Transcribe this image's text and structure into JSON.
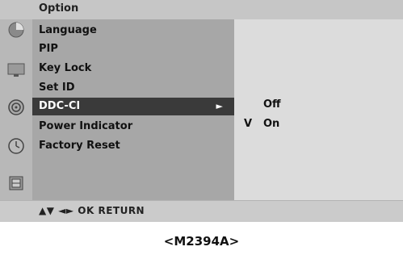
{
  "header": {
    "title": "Option"
  },
  "menu": {
    "items": [
      {
        "label": "Language"
      },
      {
        "label": "PIP"
      },
      {
        "label": "Key Lock"
      },
      {
        "label": "Set ID"
      },
      {
        "label": "DDC-CI",
        "selected": true,
        "arrow": "►"
      },
      {
        "label": "Power Indicator"
      },
      {
        "label": "Factory Reset"
      }
    ]
  },
  "submenu": {
    "options": [
      {
        "check": "",
        "label": "Off"
      },
      {
        "check": "V",
        "label": "On"
      }
    ]
  },
  "icons": [
    {
      "name": "picture-icon"
    },
    {
      "name": "screen-icon"
    },
    {
      "name": "sound-icon"
    },
    {
      "name": "time-icon"
    },
    {
      "name": "option-icon"
    }
  ],
  "footer": {
    "nav": "▲▼  ◄►  OK  RETURN"
  },
  "caption": "<M2394A>",
  "colors": {
    "header_bg": "#c6c6c6",
    "menu_bg": "#a7a7a7",
    "selected_bg": "#3a3a3a",
    "submenu_bg": "#dcdcdc",
    "icon_col_bg": "#b8b8b8"
  }
}
